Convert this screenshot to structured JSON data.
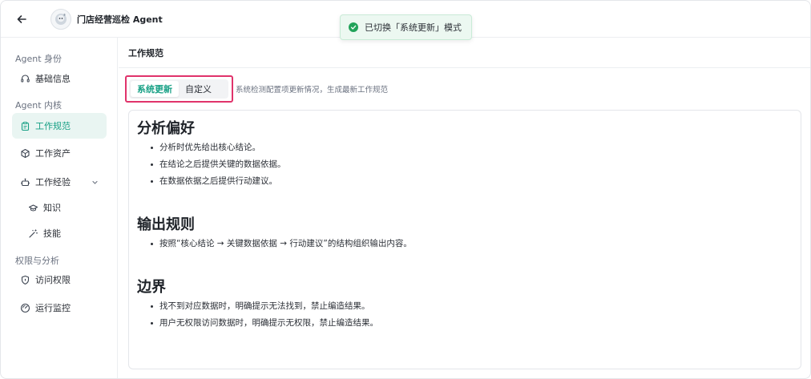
{
  "header": {
    "title": "门店经营巡检 Agent",
    "back_icon": "arrow-left-icon",
    "avatar_icon": "agent-avatar"
  },
  "toast": {
    "text": "已切换「系统更新」模式",
    "icon": "check-circle-icon",
    "color": "#22a35a"
  },
  "sidebar": {
    "sections": [
      {
        "label": "Agent 身份"
      },
      {
        "label": "Agent 内核"
      },
      {
        "label": "权限与分析"
      }
    ],
    "items": [
      {
        "label": "基础信息",
        "icon": "headset-icon"
      },
      {
        "label": "工作规范",
        "icon": "clipboard-icon",
        "active": true
      },
      {
        "label": "工作资产",
        "icon": "cube-icon"
      },
      {
        "label": "工作经验",
        "icon": "bot-icon",
        "expandable": true
      },
      {
        "label": "知识",
        "icon": "graduation-cap-icon"
      },
      {
        "label": "技能",
        "icon": "magic-wand-icon"
      },
      {
        "label": "访问权限",
        "icon": "shield-icon"
      },
      {
        "label": "运行监控",
        "icon": "gauge-icon"
      }
    ],
    "accent_color": "#17a085"
  },
  "main": {
    "title": "工作规范",
    "modes": [
      {
        "label": "系统更新",
        "selected": true
      },
      {
        "label": "自定义",
        "selected": false
      }
    ],
    "mode_description": "系统检测配置项更新情况，生成最新工作规范",
    "highlight_color": "#e0336b",
    "sections": [
      {
        "heading": "分析偏好",
        "bullets": [
          "分析时优先给出核心结论。",
          "在结论之后提供关键的数据依据。",
          "在数据依据之后提供行动建议。"
        ]
      },
      {
        "heading": "输出规则",
        "bullets": [
          "按照“核心结论 → 关键数据依据 → 行动建议”的结构组织输出内容。"
        ]
      },
      {
        "heading": "边界",
        "bullets": [
          "找不到对应数据时，明确提示无法找到，禁止编造结果。",
          "用户无权限访问数据时，明确提示无权限，禁止编造结果。"
        ]
      }
    ]
  }
}
